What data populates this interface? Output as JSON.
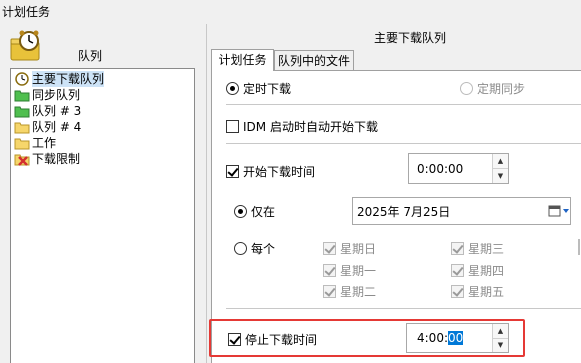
{
  "window": {
    "title": "计划任务"
  },
  "queue_panel": {
    "header": "队列",
    "items": [
      {
        "label": "主要下载队列",
        "icon": "main-queue-icon",
        "selected": true
      },
      {
        "label": "同步队列",
        "icon": "green-folder-icon"
      },
      {
        "label": "队列 # 3",
        "icon": "green-folder-icon"
      },
      {
        "label": "队列 # 4",
        "icon": "yellow-folder-icon"
      },
      {
        "label": "工作",
        "icon": "yellow-folder-icon"
      },
      {
        "label": "下载限制",
        "icon": "red-x-icon"
      }
    ]
  },
  "right_pane": {
    "header": "主要下载队列",
    "tabs": [
      {
        "label": "计划任务",
        "active": true
      },
      {
        "label": "队列中的文件",
        "active": false
      }
    ],
    "schedule": {
      "mode_once": "定时下载",
      "mode_periodic": "定期同步",
      "idm_startup": "IDM 启动时自动开始下载",
      "start_time_label": "开始下载时间",
      "start_time_value": "0:00:00",
      "only_on_label": "仅在",
      "date_value": "2025年  7月25日",
      "every_label": "每个",
      "weekdays": [
        "星期日",
        "星期一",
        "星期二",
        "星期三",
        "星期四",
        "星期五"
      ],
      "stop_time_label": "停止下载时间",
      "stop_time_prefix": "4:00:",
      "stop_time_selected": "00"
    }
  },
  "colors": {
    "highlight_frame": "#e53935",
    "selection": "#0078d7"
  }
}
